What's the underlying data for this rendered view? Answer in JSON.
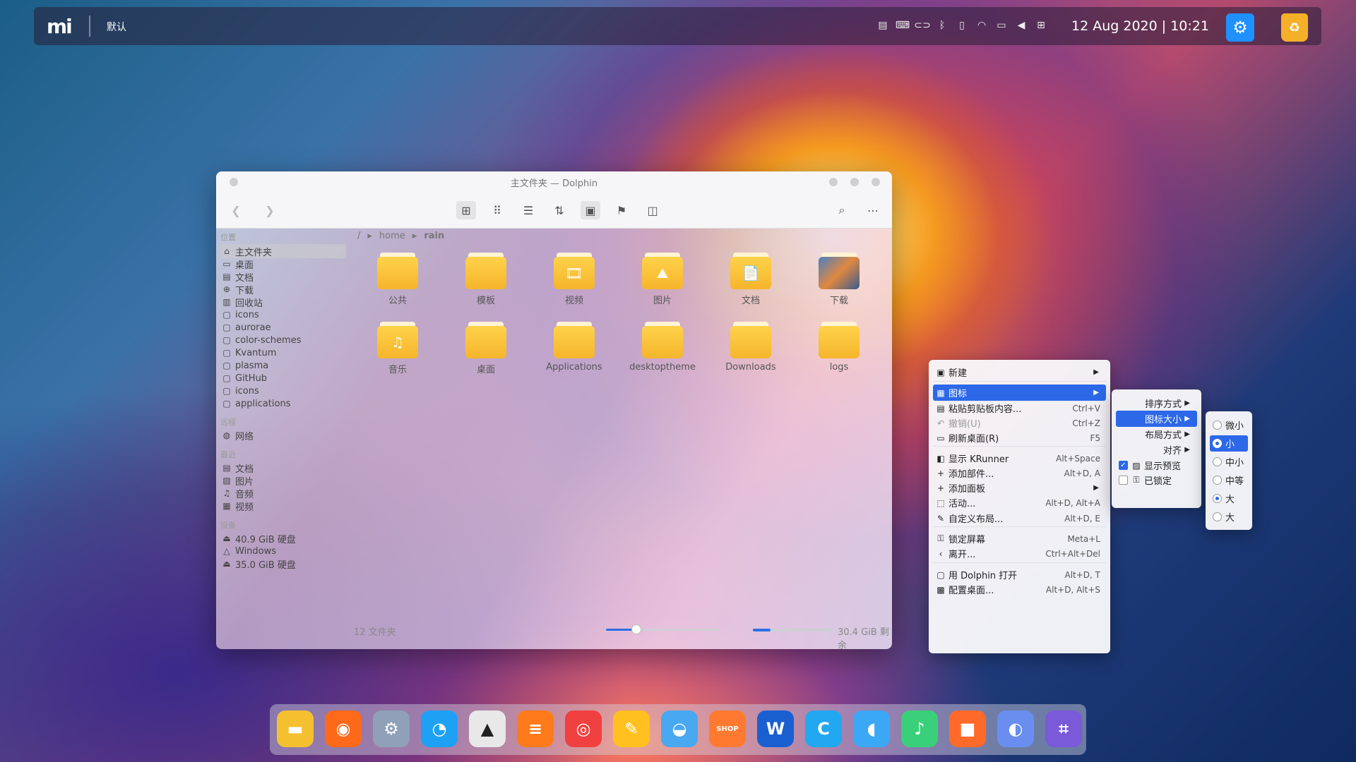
{
  "topbar": {
    "logo": "mi",
    "activity": "默认",
    "date": "12 Aug 2020 | 10:21",
    "tray_icons": [
      "clipboard-icon",
      "keyboard-icon",
      "toggle-icon",
      "bluetooth-icon",
      "battery-icon",
      "wifi-icon",
      "display-icon",
      "volume-icon",
      "grid-icon"
    ]
  },
  "window": {
    "title": "主文件夹 — Dolphin",
    "breadcrumb": [
      "/",
      "home",
      "rain"
    ],
    "sidebar": {
      "places_header": "位置",
      "remote_header": "远程",
      "recent_header": "最近",
      "devices_header": "设备",
      "places": [
        {
          "label": "主文件夹",
          "icon": "home-icon"
        },
        {
          "label": "桌面",
          "icon": "desktop-icon"
        },
        {
          "label": "文档",
          "icon": "document-icon"
        },
        {
          "label": "下载",
          "icon": "download-icon"
        },
        {
          "label": "回收站",
          "icon": "trash-icon"
        },
        {
          "label": "icons",
          "icon": "folder-icon"
        },
        {
          "label": "aurorae",
          "icon": "folder-icon"
        },
        {
          "label": "color-schemes",
          "icon": "folder-icon"
        },
        {
          "label": "Kvantum",
          "icon": "folder-icon"
        },
        {
          "label": "plasma",
          "icon": "folder-icon"
        },
        {
          "label": "GitHub",
          "icon": "folder-icon"
        },
        {
          "label": "icons",
          "icon": "folder-icon"
        },
        {
          "label": "applications",
          "icon": "folder-icon"
        }
      ],
      "remote": [
        {
          "label": "网络",
          "icon": "network-icon"
        }
      ],
      "recent": [
        {
          "label": "文档",
          "icon": "document-icon"
        },
        {
          "label": "图片",
          "icon": "image-icon"
        },
        {
          "label": "音频",
          "icon": "music-icon"
        },
        {
          "label": "视频",
          "icon": "video-icon"
        }
      ],
      "devices": [
        {
          "label": "40.9 GiB 硬盘",
          "icon": "drive-icon"
        },
        {
          "label": "Windows",
          "icon": "drive-warning-icon"
        },
        {
          "label": "35.0 GiB 硬盘",
          "icon": "drive-icon"
        }
      ]
    },
    "files": [
      {
        "label": "公共",
        "glyph": ""
      },
      {
        "label": "模板",
        "glyph": ""
      },
      {
        "label": "视频",
        "glyph": "🎞"
      },
      {
        "label": "图片",
        "glyph": "⛰"
      },
      {
        "label": "文档",
        "glyph": "📄"
      },
      {
        "label": "下载",
        "glyph": ""
      },
      {
        "label": "音乐",
        "glyph": "♫"
      },
      {
        "label": "桌面",
        "glyph": ""
      },
      {
        "label": "Applications",
        "glyph": ""
      },
      {
        "label": "desktoptheme",
        "glyph": ""
      },
      {
        "label": "Downloads",
        "glyph": ""
      },
      {
        "label": "logs",
        "glyph": ""
      }
    ],
    "status": "12 文件夹",
    "free_space": "30.4 GiB 剩余",
    "zoom_fraction": 0.27,
    "disk_used_fraction": 0.22
  },
  "context_menu": [
    {
      "label": "新建",
      "icon": "new-icon",
      "shortcut": "",
      "arrow": true
    },
    {
      "label": "图标",
      "icon": "icons-icon",
      "shortcut": "",
      "arrow": true,
      "highlight": true
    },
    {
      "label": "粘贴剪贴板内容...",
      "icon": "paste-icon",
      "shortcut": "Ctrl+V"
    },
    {
      "label": "撤销(U)",
      "icon": "undo-icon",
      "shortcut": "Ctrl+Z",
      "disabled": true
    },
    {
      "label": "刷新桌面(R)",
      "icon": "refresh-icon",
      "shortcut": "F5"
    },
    {
      "label": "显示 KRunner",
      "icon": "krunner-icon",
      "shortcut": "Alt+Space"
    },
    {
      "label": "添加部件...",
      "icon": "plus-icon",
      "shortcut": "Alt+D, A"
    },
    {
      "label": "添加面板",
      "icon": "plus-icon",
      "shortcut": "",
      "arrow": true
    },
    {
      "label": "活动...",
      "icon": "activities-icon",
      "shortcut": "Alt+D, Alt+A"
    },
    {
      "label": "自定义布局...",
      "icon": "pencil-icon",
      "shortcut": "Alt+D, E"
    },
    {
      "label": "锁定屏幕",
      "icon": "lock-icon",
      "shortcut": "Meta+L"
    },
    {
      "label": "离开...",
      "icon": "leave-icon",
      "shortcut": "Ctrl+Alt+Del"
    },
    {
      "label": "用 Dolphin 打开",
      "icon": "folder-icon",
      "shortcut": "Alt+D, T"
    },
    {
      "label": "配置桌面...",
      "icon": "configure-icon",
      "shortcut": "Alt+D, Alt+S"
    }
  ],
  "icons_submenu": [
    {
      "label": "排序方式",
      "arrow": true
    },
    {
      "label": "图标大小",
      "arrow": true,
      "highlight": true
    },
    {
      "label": "布局方式",
      "arrow": true
    },
    {
      "label": "对齐",
      "arrow": true
    },
    {
      "label": "显示预览",
      "checked": true
    },
    {
      "label": "已锁定",
      "checked": false
    }
  ],
  "size_submenu": [
    {
      "label": "微小",
      "selected": false
    },
    {
      "label": "小",
      "selected": true,
      "highlight": true
    },
    {
      "label": "中小",
      "selected": false
    },
    {
      "label": "中等",
      "selected": false
    },
    {
      "label": "大",
      "selected": true
    },
    {
      "label": "大",
      "selected": false
    }
  ],
  "dock": [
    {
      "name": "files-app",
      "color": "#f5c030",
      "glyph": "▬"
    },
    {
      "name": "firefox-app",
      "color": "#ff6a1a",
      "glyph": "◉"
    },
    {
      "name": "settings-app",
      "color": "#8fa0b8",
      "glyph": "⚙"
    },
    {
      "name": "qq-app",
      "color": "#1ea0f5",
      "glyph": "◔"
    },
    {
      "name": "inkscape-app",
      "color": "#e8e8e8",
      "glyph": "▲"
    },
    {
      "name": "notes-app",
      "color": "#ff7a1a",
      "glyph": "≡"
    },
    {
      "name": "music-netease-app",
      "color": "#f04040",
      "glyph": "◎"
    },
    {
      "name": "editor-app",
      "color": "#ffc020",
      "glyph": "✎"
    },
    {
      "name": "github-app",
      "color": "#48a8f0",
      "glyph": "◒"
    },
    {
      "name": "shop-app",
      "color": "#ff7a30",
      "glyph": "SHOP"
    },
    {
      "name": "word-app",
      "color": "#1a5fd0",
      "glyph": "W"
    },
    {
      "name": "browser-app",
      "color": "#22a8f0",
      "glyph": "C"
    },
    {
      "name": "chat-app",
      "color": "#3aa8f5",
      "glyph": "◖"
    },
    {
      "name": "music-app",
      "color": "#3ad07a",
      "glyph": "♪"
    },
    {
      "name": "video-app",
      "color": "#ff6a2a",
      "glyph": "■"
    },
    {
      "name": "screenshot-app",
      "color": "#6a8ef0",
      "glyph": "◐"
    },
    {
      "name": "crop-app",
      "color": "#7a5ad8",
      "glyph": "⌗"
    }
  ]
}
